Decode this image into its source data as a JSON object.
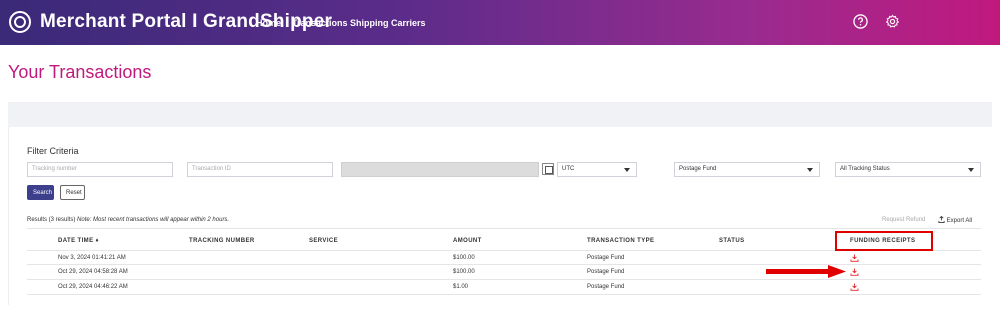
{
  "header": {
    "brand": "Merchant Portal I GrandShipper",
    "nav": [
      {
        "label": "Home"
      },
      {
        "label": "Transactions"
      },
      {
        "label": "Shipping Carriers"
      }
    ],
    "icons": [
      "logo-icon",
      "help-icon",
      "gear-icon"
    ],
    "gradient_colors": [
      "#3a2a78",
      "#c0197e"
    ]
  },
  "page": {
    "title": "Your Transactions",
    "title_color": "#c0197e"
  },
  "filters": {
    "title": "Filter Criteria",
    "tracking_placeholder": "Tracking number",
    "transaction_id_placeholder": "Transaction ID",
    "date_range_value": "",
    "timezone": "UTC",
    "fund_type": "Postage Fund",
    "tracking_status": "All Tracking Status",
    "search_label": "Search",
    "reset_label": "Reset"
  },
  "results": {
    "count_text": "Results (3 results)",
    "note_text": "Note: Most recent transactions will appear within 2 hours.",
    "request_refund_label": "Request Refund",
    "export_all_label": "Export All"
  },
  "table": {
    "columns": [
      "DATE TIME ♦",
      "TRACKING NUMBER",
      "SERVICE",
      "AMOUNT",
      "TRANSACTION TYPE",
      "STATUS",
      "FUNDING RECEIPTS"
    ],
    "rows": [
      {
        "date_time": "Nov 3, 2024 01:41:21 AM",
        "tracking_number": "",
        "service": "",
        "amount": "$100.00",
        "transaction_type": "Postage Fund",
        "status": "",
        "receipt_icon": "download-icon"
      },
      {
        "date_time": "Oct 29, 2024 04:58:28 AM",
        "tracking_number": "",
        "service": "",
        "amount": "$100.00",
        "transaction_type": "Postage Fund",
        "status": "",
        "receipt_icon": "download-icon"
      },
      {
        "date_time": "Oct 29, 2024 04:46:22 AM",
        "tracking_number": "",
        "service": "",
        "amount": "$1.00",
        "transaction_type": "Postage Fund",
        "status": "",
        "receipt_icon": "download-icon"
      }
    ]
  },
  "annotation": {
    "highlight_color": "#e00000",
    "arrow_color": "#e00000"
  }
}
